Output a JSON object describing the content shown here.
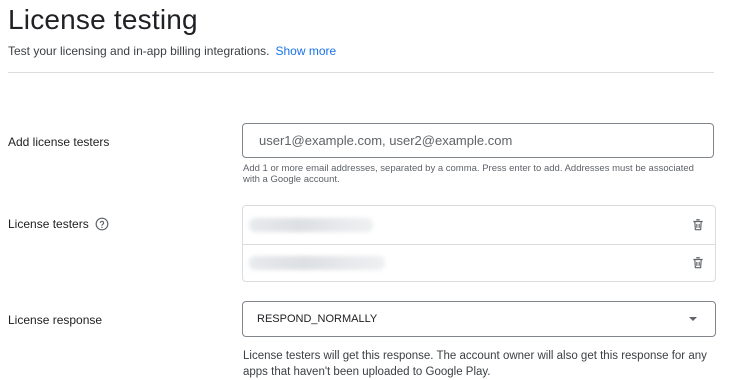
{
  "page": {
    "title": "License testing",
    "subtitle": "Test your licensing and in-app billing integrations.",
    "show_more": "Show more"
  },
  "add_testers": {
    "label": "Add license testers",
    "placeholder": "user1@example.com, user2@example.com",
    "hint": "Add 1 or more email addresses, separated by a comma. Press enter to add. Addresses must be associated with a Google account."
  },
  "license_testers": {
    "label": "License testers",
    "help_icon": "help-circle-icon",
    "rows": [
      {
        "email_redacted": true,
        "action_icon": "trash-icon"
      },
      {
        "email_redacted": true,
        "action_icon": "trash-icon"
      }
    ]
  },
  "license_response": {
    "label": "License response",
    "selected": "RESPOND_NORMALLY",
    "hint": "License testers will get this response. The account owner will also get this response for any apps that haven't been uploaded to Google Play."
  },
  "colors": {
    "link": "#1a73e8",
    "border": "#80868b",
    "divider": "#dadce0",
    "text": "#202124",
    "muted": "#5f6368"
  }
}
